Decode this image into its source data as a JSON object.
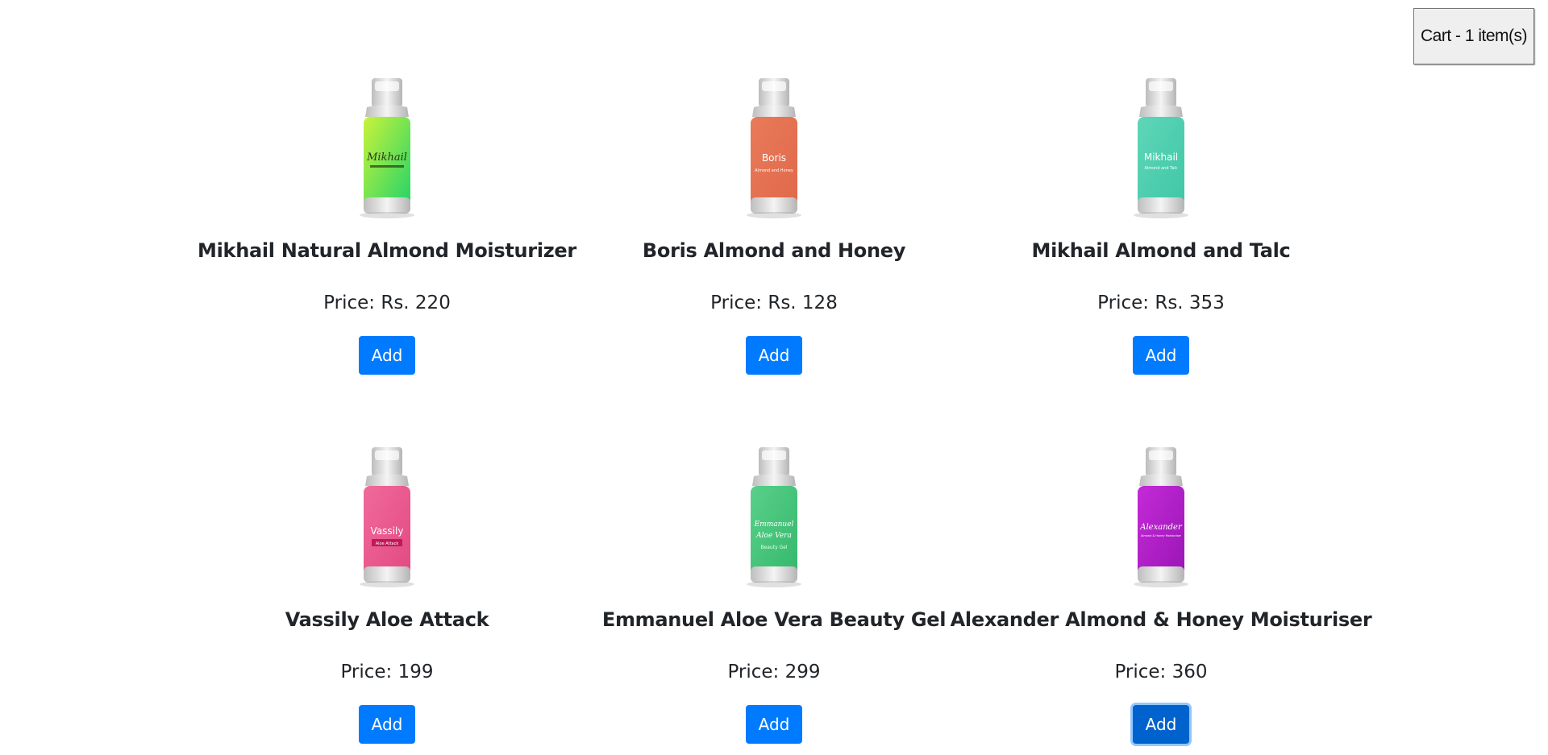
{
  "cart": {
    "label": "Cart - 1 item(s)"
  },
  "products": [
    {
      "name": "Mikhail Natural Almond Moisturizer",
      "price": "Price: Rs. 220",
      "add_label": "Add",
      "label_top": "Mikhail",
      "label_bottom": "",
      "color_a": "#c9f33a",
      "color_b": "#22d36a",
      "label_color": "#2a3a10"
    },
    {
      "name": "Boris Almond and Honey",
      "price": "Price: Rs. 128",
      "add_label": "Add",
      "label_top": "Boris",
      "label_bottom": "Almond and Honey",
      "color_a": "#e87a5a",
      "color_b": "#e0694a",
      "label_color": "#ffffff"
    },
    {
      "name": "Mikhail Almond and Talc",
      "price": "Price: Rs. 353",
      "add_label": "Add",
      "label_top": "Mikhail",
      "label_bottom": "Almond and Talc",
      "color_a": "#5fd6b8",
      "color_b": "#3fc7a6",
      "label_color": "#ffffff"
    },
    {
      "name": "Vassily Aloe Attack",
      "price": "Price: 199",
      "add_label": "Add",
      "label_top": "Vassily",
      "label_bottom": "Aloe Attack",
      "color_a": "#f06a9a",
      "color_b": "#e24a82",
      "label_color": "#ffffff"
    },
    {
      "name": "Emmanuel Aloe Vera Beauty Gel",
      "price": "Price: 299",
      "add_label": "Add",
      "label_top": "Emmanuel Aloe Vera",
      "label_bottom": "Beauty Gel",
      "color_a": "#5ad08a",
      "color_b": "#34b86c",
      "label_color": "#ffffff"
    },
    {
      "name": "Alexander Almond & Honey Moisturiser",
      "price": "Price: 360",
      "add_label": "Add",
      "label_top": "Alexander",
      "label_bottom": "Almond & Honey Moisturiser",
      "color_a": "#c42ad8",
      "color_b": "#9a16b4",
      "label_color": "#ffffff"
    }
  ],
  "colors": {
    "primary": "#007bff",
    "primary_focused": "#0062cc"
  }
}
